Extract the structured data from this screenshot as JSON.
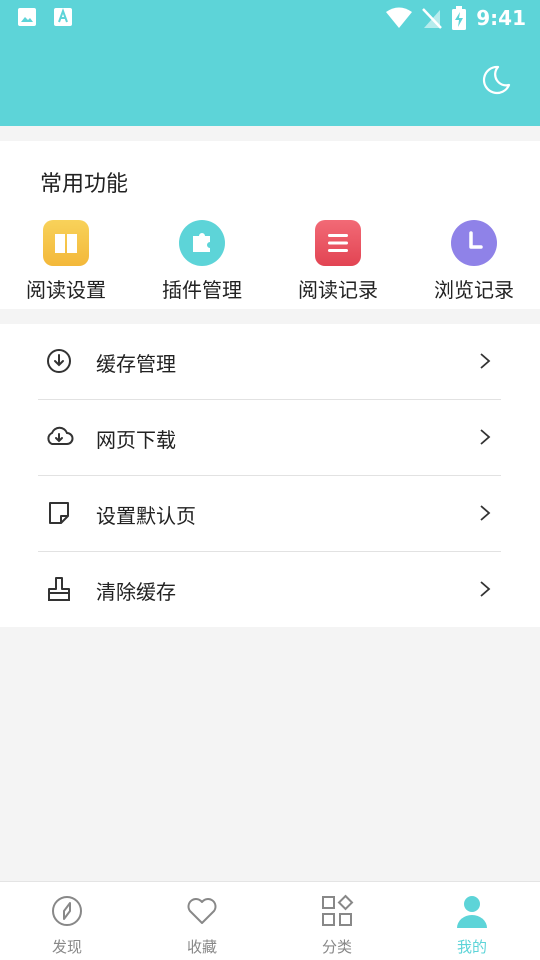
{
  "status_bar": {
    "time": "9:41"
  },
  "colors": {
    "accent": "#5dd4d8",
    "book": "#f5c143",
    "plugin": "#5dd4d8",
    "history": "#ee5261",
    "browse": "#8f82e8",
    "inactive": "#888888"
  },
  "common": {
    "title": "常用功能",
    "items": [
      {
        "label": "阅读设置",
        "icon": "book-icon"
      },
      {
        "label": "插件管理",
        "icon": "puzzle-icon"
      },
      {
        "label": "阅读记录",
        "icon": "list-icon"
      },
      {
        "label": "浏览记录",
        "icon": "clock-icon"
      }
    ]
  },
  "menu": [
    {
      "label": "缓存管理",
      "icon": "download-circle-icon"
    },
    {
      "label": "网页下载",
      "icon": "cloud-download-icon"
    },
    {
      "label": "设置默认页",
      "icon": "page-icon"
    },
    {
      "label": "清除缓存",
      "icon": "brush-icon"
    }
  ],
  "bottom_nav": [
    {
      "label": "发现",
      "icon": "compass-icon",
      "active": false
    },
    {
      "label": "收藏",
      "icon": "heart-icon",
      "active": false
    },
    {
      "label": "分类",
      "icon": "grid-icon",
      "active": false
    },
    {
      "label": "我的",
      "icon": "person-icon",
      "active": true
    }
  ]
}
